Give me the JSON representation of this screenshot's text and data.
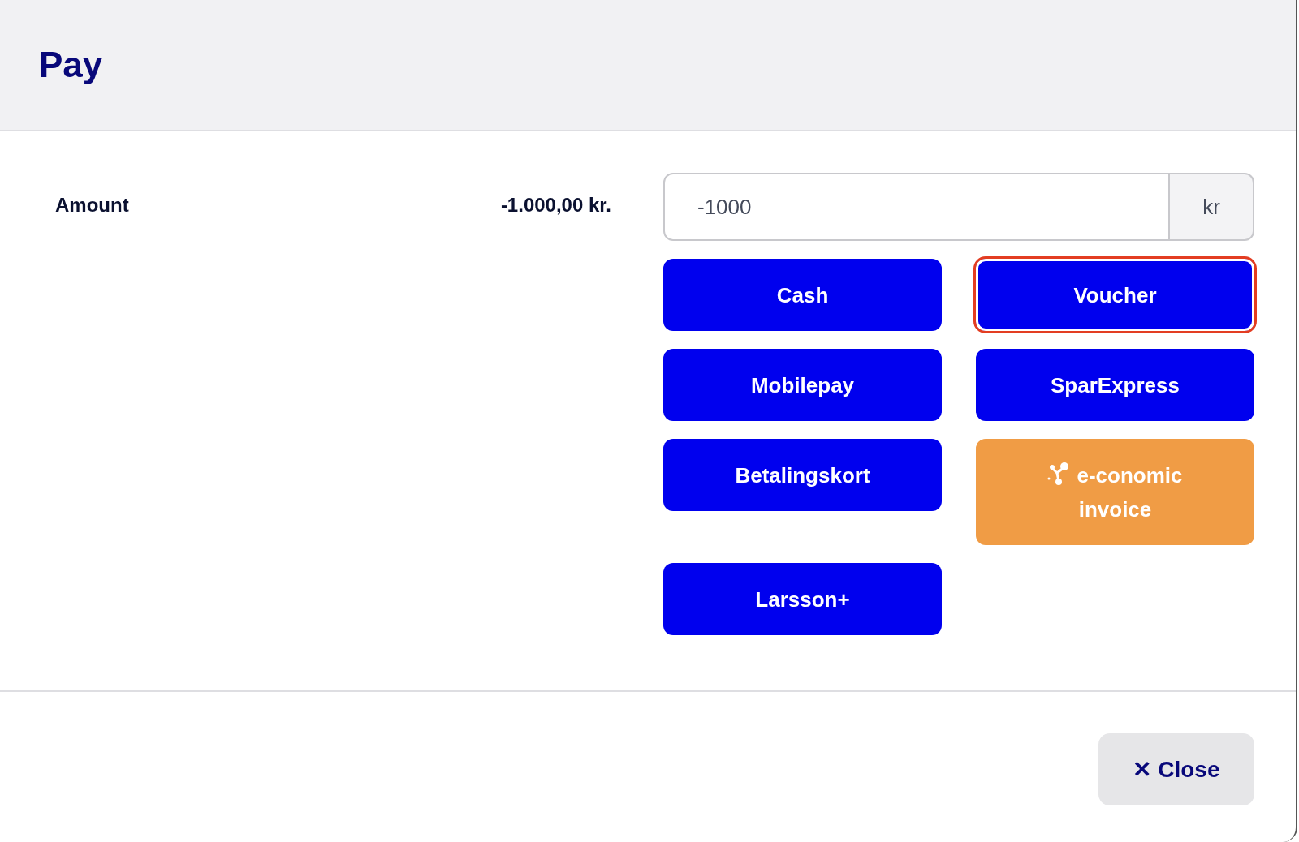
{
  "dialog": {
    "title": "Pay"
  },
  "amount": {
    "label": "Amount",
    "value": "-1.000,00 kr.",
    "input_value": "-1000",
    "unit": "kr"
  },
  "payment_methods": [
    {
      "label": "Cash",
      "kind": "primary",
      "focused": false
    },
    {
      "label": "Voucher",
      "kind": "primary",
      "focused": true
    },
    {
      "label": "Mobilepay",
      "kind": "primary",
      "focused": false
    },
    {
      "label": "SparExpress",
      "kind": "primary",
      "focused": false
    },
    {
      "label": "Betalingskort",
      "kind": "primary",
      "focused": false
    },
    {
      "label": "e-conomic invoice",
      "kind": "integration",
      "focused": false
    },
    {
      "label": "Larsson+",
      "kind": "primary",
      "focused": false
    }
  ],
  "footer": {
    "close_icon": "✕",
    "close_label": "Close"
  }
}
